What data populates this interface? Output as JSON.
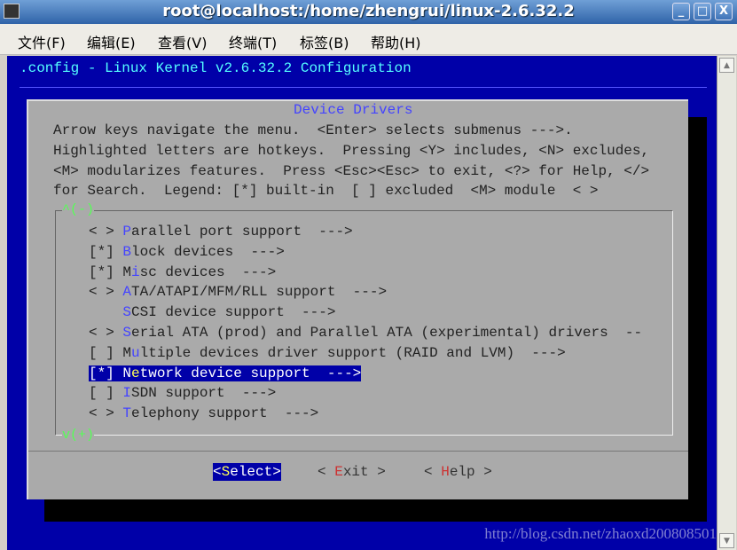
{
  "window": {
    "title": "root@localhost:/home/zhengrui/linux-2.6.32.2",
    "minimize": "_",
    "maximize": "□",
    "close": "X"
  },
  "menu": [
    "文件(F)",
    "编辑(E)",
    "查看(V)",
    "终端(T)",
    "标签(B)",
    "帮助(H)"
  ],
  "terminal": {
    "header": ".config - Linux Kernel v2.6.32.2 Configuration",
    "dialog_title": "Device Drivers",
    "help_lines": [
      "Arrow keys navigate the menu.  <Enter> selects submenus --->.",
      "Highlighted letters are hotkeys.  Pressing <Y> includes, <N> excludes,",
      "<M> modularizes features.  Press <Esc><Esc> to exit, <?> for Help, </>",
      "for Search.  Legend: [*] built-in  [ ] excluded  <M> module  < >"
    ],
    "scroll_up": "^(-)",
    "scroll_down": "v(+)",
    "items": [
      {
        "prefix": "< > ",
        "pre": "",
        "hot": "P",
        "post": "arallel port support  --->"
      },
      {
        "prefix": "[*] ",
        "pre": "",
        "hot": "B",
        "post": "lock devices  --->"
      },
      {
        "prefix": "[*] ",
        "pre": "M",
        "hot": "i",
        "post": "sc devices  --->"
      },
      {
        "prefix": "< > ",
        "pre": "",
        "hot": "A",
        "post": "TA/ATAPI/MFM/RLL support  --->"
      },
      {
        "prefix": "    ",
        "pre": "",
        "hot": "S",
        "post": "CSI device support  --->"
      },
      {
        "prefix": "< > ",
        "pre": "",
        "hot": "S",
        "post": "erial ATA (prod) and Parallel ATA (experimental) drivers  --"
      },
      {
        "prefix": "[ ] ",
        "pre": "M",
        "hot": "u",
        "post": "ltiple devices driver support (RAID and LVM)  --->"
      },
      {
        "prefix": "[*] ",
        "pre": "N",
        "hot": "e",
        "post": "twork device support  --->",
        "selected": true
      },
      {
        "prefix": "[ ] ",
        "pre": "",
        "hot": "I",
        "post": "SDN support  --->"
      },
      {
        "prefix": "< > ",
        "pre": "",
        "hot": "T",
        "post": "elephony support  --->"
      }
    ],
    "buttons": [
      {
        "pre": "<",
        "hot": "S",
        "post": "elect>",
        "active": true
      },
      {
        "pre": "< ",
        "hot": "E",
        "post": "xit >"
      },
      {
        "pre": "< ",
        "hot": "H",
        "post": "elp >"
      }
    ],
    "watermark": "http://blog.csdn.net/zhaoxd200808501"
  }
}
